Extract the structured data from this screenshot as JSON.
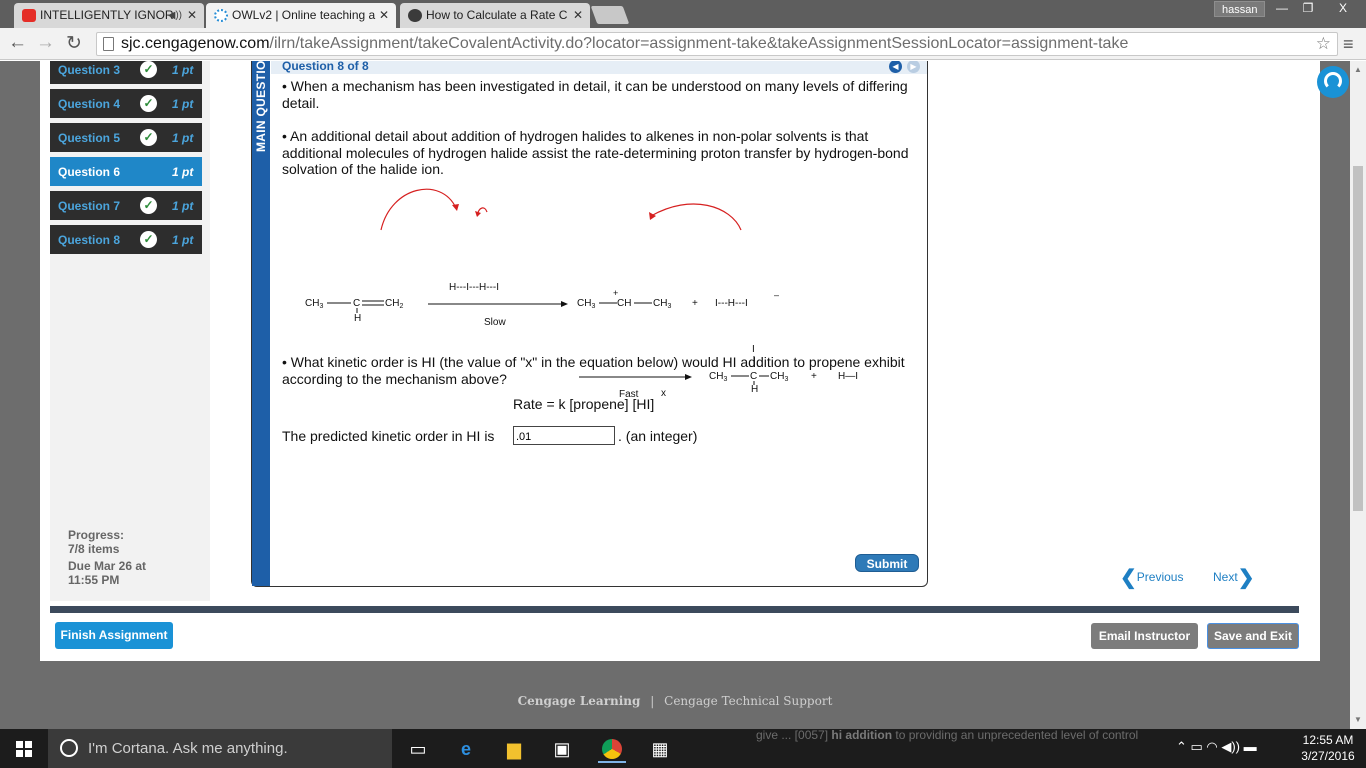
{
  "browser": {
    "tabs": [
      {
        "title": "INTELLIGENTLY IGNOR"
      },
      {
        "title": "OWLv2 | Online teaching a"
      },
      {
        "title": "How to Calculate a Rate C"
      }
    ],
    "user": "hassan",
    "window_controls": {
      "minimize": "—",
      "restore": "❐",
      "close": "X"
    },
    "url_host": "sjc.cengagenow.com",
    "url_path": "/ilrn/takeAssignment/takeCovalentActivity.do?locator=assignment-take&takeAssignmentSessionLocator=assignment-take"
  },
  "sidebar": {
    "items": [
      {
        "label": "Question 3",
        "points": "1 pt"
      },
      {
        "label": "Question 4",
        "points": "1 pt"
      },
      {
        "label": "Question 5",
        "points": "1 pt"
      },
      {
        "label": "Question 6",
        "points": "1 pt"
      },
      {
        "label": "Question 7",
        "points": "1 pt"
      },
      {
        "label": "Question 8",
        "points": "1 pt"
      }
    ],
    "progress_label": "Progress:",
    "progress_value": "7/8 items",
    "due_line1": "Due Mar 26 at",
    "due_line2": "11:55 PM"
  },
  "question": {
    "side_label": "MAIN QUESTION",
    "title": "Question 8 of 8",
    "para1": "• When a mechanism has been investigated in detail, it can be understood on many levels of differing detail.",
    "para2": "• An additional detail about addition of hydrogen halides to alkenes in non-polar solvents is that additional molecules of hydrogen halide assist the rate-determining proton transfer by hydrogen-bond solvation of the halide ion.",
    "para3": "• What kinetic order is HI (the value of \"x\" in the equation below) would HI addition to propene exhibit according to the mechanism above?",
    "rate_equation": "Rate = k [propene] [HI]",
    "rate_exponent": "x",
    "answer_prefix": "The predicted kinetic order in HI is",
    "answer_value": ".01",
    "answer_suffix": ".  (an integer)",
    "submit_label": "Submit"
  },
  "mechanism": {
    "slow_label": "Slow",
    "fast_label": "Fast",
    "plus": "+",
    "reactant_ch3": "CH",
    "reactant_c": "C",
    "reactant_ch2": "CH",
    "reactant_h": "H",
    "hih": "H---I---H---I",
    "cation_ch3": "CH",
    "cation_ch": "CH",
    "cation_ch3b": "CH",
    "anion": "I---H---I",
    "product_ch3": "CH",
    "product_c": "C",
    "product_ch3b": "CH",
    "product_h": "H",
    "product_i": "I",
    "hi": "H—I",
    "sub3": "3",
    "sub2": "2",
    "charge_plus": "+",
    "charge_minus": "–"
  },
  "nav": {
    "previous": "Previous",
    "next": "Next"
  },
  "actions": {
    "finish": "Finish Assignment",
    "email": "Email Instructor",
    "save_exit": "Save and Exit"
  },
  "footer": {
    "brand": "Cengage Learning",
    "separator": "|",
    "support": "Cengage Technical Support"
  },
  "taskbar": {
    "cortana": "I'm Cortana. Ask me anything.",
    "ghost_pre": "give ... [0057]",
    "ghost_bold": "hi addition",
    "ghost_post": "to providing an unprecedented level of control",
    "time": "12:55 AM",
    "date": "3/27/2016"
  },
  "colors": {
    "accent": "#1a92d6",
    "sidebar_active": "#1f87c8",
    "question_bar": "#1e5fa8",
    "check": "#2d8c3a"
  }
}
